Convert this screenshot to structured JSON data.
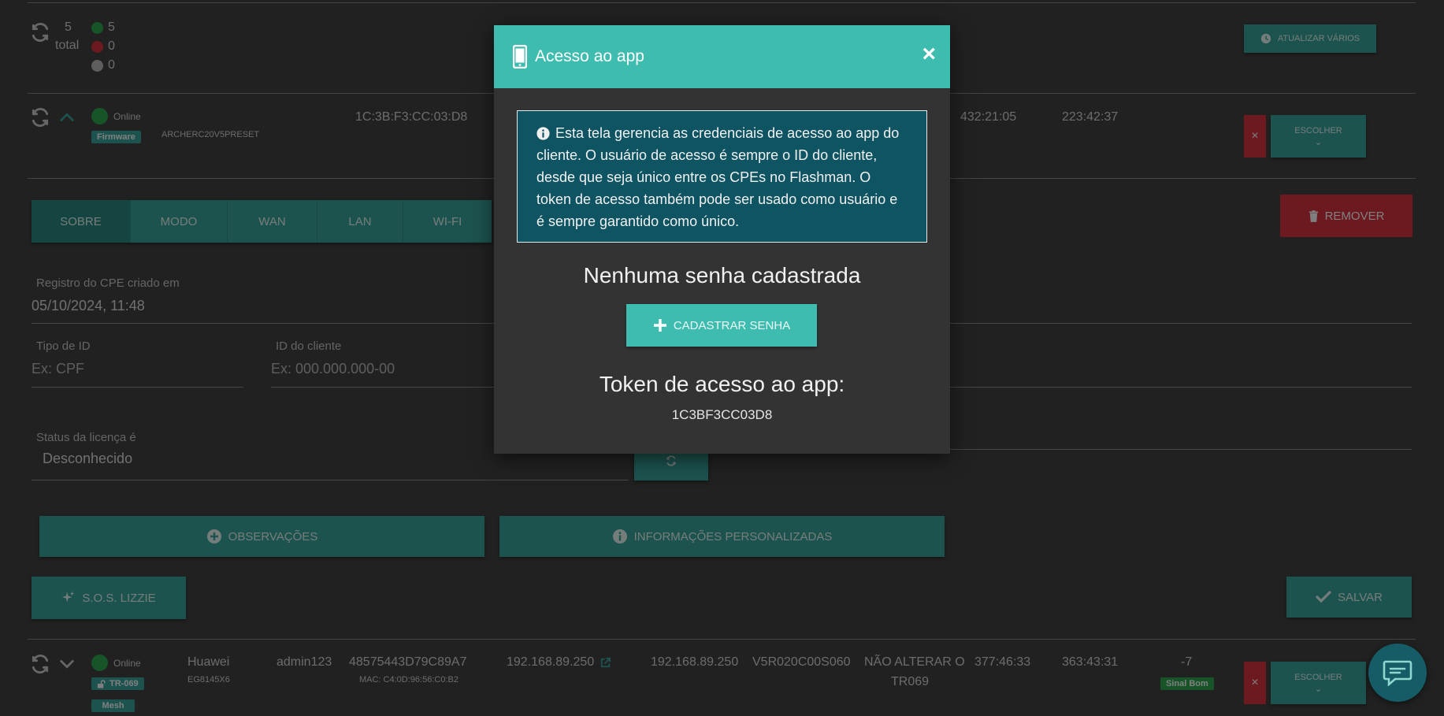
{
  "summary": {
    "total_count": "5",
    "total_label": "total",
    "online_count": "5",
    "offline_count": "0",
    "unknown_count": "0",
    "update_many_label": "ATUALIZAR VÁRIOS"
  },
  "device1": {
    "status": "Online",
    "firmware_tag": "Firmware",
    "preset": "ARCHERC20V5PRESET",
    "mac": "1C:3B:F3:CC:03:D8",
    "time1": "432:21:05",
    "time2": "223:42:37",
    "choose_label": "ESCOLHER",
    "choose_caret": "⌄",
    "remove_x": "×"
  },
  "tabs": [
    "SOBRE",
    "MODO",
    "WAN",
    "LAN",
    "WI-FI"
  ],
  "remove_label": "REMOVER",
  "form": {
    "created_label": "Registro do CPE criado em",
    "created_value": "05/10/2024, 11:48",
    "id_type_label": "Tipo de ID",
    "id_type_placeholder": "Ex: CPF",
    "client_id_label": "ID do cliente",
    "client_id_placeholder": "Ex: 000.000.000-00",
    "license_label": "Status da licença é",
    "license_value": "Desconhecido"
  },
  "buttons": {
    "observations": "OBSERVAÇÕES",
    "custom_info": "INFORMAÇÕES PERSONALIZADAS",
    "sos": "S.O.S. LIZZIE",
    "save": "SALVAR"
  },
  "device2": {
    "status": "Online",
    "tr_tag": "TR-069",
    "mesh_tag": "Mesh",
    "vendor": "Huawei",
    "model": "EG8145X6",
    "user": "admin123",
    "serial": "48575443D79C89A7",
    "mac_line": "MAC: C4:0D:96:56:C0:B2",
    "ip1": "192.168.89.250",
    "ip2": "192.168.89.250",
    "firmware": "V5R020C00S060",
    "note_line1": "NÃO ALTERAR O",
    "note_line2": "TR069",
    "time1": "377:46:33",
    "time2": "363:43:31",
    "signal": "-7",
    "signal_tag": "Sinal Bom",
    "choose_label": "ESCOLHER",
    "choose_caret": "⌄",
    "remove_x": "×"
  },
  "modal": {
    "title": "Acesso ao app",
    "close": "×",
    "info_text": "Esta tela gerencia as credenciais de acesso ao app do cliente. O usuário de acesso é sempre o ID do cliente, desde que seja único entre os CPEs no Flashman. O token de acesso também pode ser usado como usuário e é sempre garantido como único.",
    "no_password": "Nenhuma senha cadastrada",
    "register_button": "CADASTRAR SENHA",
    "token_title": "Token de acesso ao app:",
    "token_value": "1C3BF3CC03D8"
  },
  "colors": {
    "teal": "#3aa69c",
    "modal_header": "#3fbcb0",
    "danger": "#d9323f",
    "online": "#2fa84f",
    "info_box": "#0f5462"
  },
  "icons": [
    "refresh-icon",
    "chevron-up-icon",
    "chevron-down-icon",
    "clock-icon",
    "trash-icon",
    "plus-circle-icon",
    "info-circle-icon",
    "sparkles-icon",
    "check-icon",
    "mobile-phone-icon",
    "close-icon",
    "info-icon",
    "plus-icon",
    "external-link-icon",
    "lock-open-icon",
    "chat-icon"
  ]
}
